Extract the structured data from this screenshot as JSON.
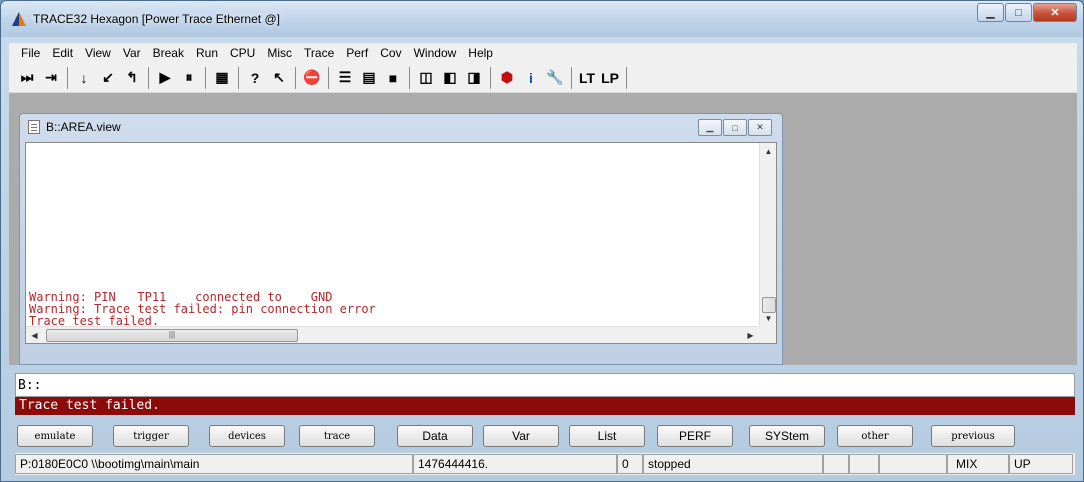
{
  "window": {
    "title": "TRACE32 Hexagon [Power Trace Ethernet @]"
  },
  "menu": [
    "File",
    "Edit",
    "View",
    "Var",
    "Break",
    "Run",
    "CPU",
    "Misc",
    "Trace",
    "Perf",
    "Cov",
    "Window",
    "Help"
  ],
  "toolbar": {
    "lt_label": "LT",
    "lp_label": "LP"
  },
  "area_window": {
    "title": "B::AREA.view",
    "lines": [
      "Warning: PIN   TP11    connected to    GND",
      "Warning: Trace test failed: pin connection error",
      "Trace test failed."
    ],
    "text_color": "#b3282d"
  },
  "command_line": {
    "value": "B::"
  },
  "message_line": {
    "text": "Trace test failed.",
    "background": "#8b0a0a"
  },
  "softkeys": [
    "emulate",
    "trigger",
    "devices",
    "trace",
    "Data",
    "Var",
    "List",
    "PERF",
    "SYStem",
    "other",
    "previous"
  ],
  "status": {
    "address": "P:0180E0C0  \\\\bootimg\\main\\main",
    "counter": "1476444416.",
    "zero": "0",
    "state": "stopped",
    "mode": "MIX",
    "direction": "UP"
  }
}
